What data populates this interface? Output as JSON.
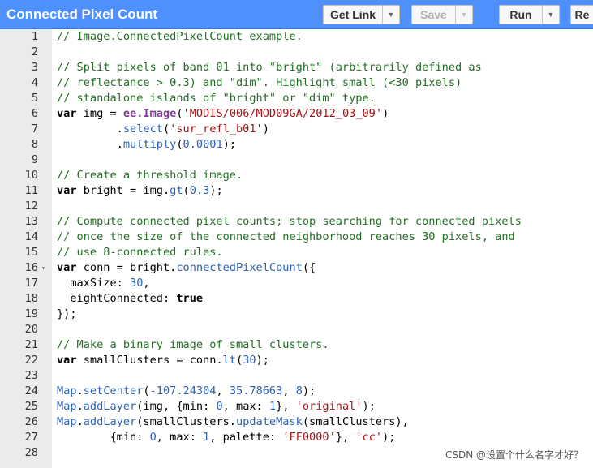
{
  "header": {
    "title": "Connected Pixel Count",
    "get_link_label": "Get Link",
    "save_label": "Save",
    "run_label": "Run",
    "reset_label": "Re"
  },
  "editor": {
    "lines": [
      {
        "n": "1",
        "parts": [
          [
            "c",
            "// Image.ConnectedPixelCount example."
          ]
        ]
      },
      {
        "n": "2",
        "parts": []
      },
      {
        "n": "3",
        "parts": [
          [
            "c",
            "// Split pixels of band 01 into \"bright\" (arbitrarily defined as"
          ]
        ]
      },
      {
        "n": "4",
        "parts": [
          [
            "c",
            "// reflectance > 0.3) and \"dim\". Highlight small (<30 pixels)"
          ]
        ]
      },
      {
        "n": "5",
        "parts": [
          [
            "c",
            "// standalone islands of \"bright\" or \"dim\" type."
          ]
        ]
      },
      {
        "n": "6",
        "parts": [
          [
            "k",
            "var"
          ],
          [
            "p",
            " img = "
          ],
          [
            "ee",
            "ee.Image"
          ],
          [
            "p",
            "("
          ],
          [
            "s",
            "'MODIS/006/MOD09GA/2012_03_09'"
          ],
          [
            "p",
            ")"
          ]
        ]
      },
      {
        "n": "7",
        "parts": [
          [
            "g",
            "         "
          ],
          [
            "p",
            "."
          ],
          [
            "f",
            "select"
          ],
          [
            "p",
            "("
          ],
          [
            "s",
            "'sur_refl_b01'"
          ],
          [
            "p",
            ")"
          ]
        ]
      },
      {
        "n": "8",
        "parts": [
          [
            "g",
            "         "
          ],
          [
            "p",
            "."
          ],
          [
            "f",
            "multiply"
          ],
          [
            "p",
            "("
          ],
          [
            "n",
            "0.0001"
          ],
          [
            "p",
            ");"
          ]
        ]
      },
      {
        "n": "9",
        "parts": []
      },
      {
        "n": "10",
        "parts": [
          [
            "c",
            "// Create a threshold image."
          ]
        ]
      },
      {
        "n": "11",
        "parts": [
          [
            "k",
            "var"
          ],
          [
            "p",
            " bright = img."
          ],
          [
            "f",
            "gt"
          ],
          [
            "p",
            "("
          ],
          [
            "n",
            "0.3"
          ],
          [
            "p",
            ");"
          ]
        ]
      },
      {
        "n": "12",
        "parts": []
      },
      {
        "n": "13",
        "parts": [
          [
            "c",
            "// Compute connected pixel counts; stop searching for connected pixels"
          ]
        ]
      },
      {
        "n": "14",
        "parts": [
          [
            "c",
            "// once the size of the connected neighborhood reaches 30 pixels, and"
          ]
        ]
      },
      {
        "n": "15",
        "parts": [
          [
            "c",
            "// use 8-connected rules."
          ]
        ]
      },
      {
        "n": "16",
        "fold": true,
        "parts": [
          [
            "k",
            "var"
          ],
          [
            "p",
            " conn = bright."
          ],
          [
            "f",
            "connectedPixelCount"
          ],
          [
            "p",
            "({"
          ]
        ]
      },
      {
        "n": "17",
        "parts": [
          [
            "p",
            "  maxSize: "
          ],
          [
            "n",
            "30"
          ],
          [
            "p",
            ","
          ]
        ]
      },
      {
        "n": "18",
        "parts": [
          [
            "p",
            "  eightConnected: "
          ],
          [
            "k",
            "true"
          ]
        ]
      },
      {
        "n": "19",
        "parts": [
          [
            "p",
            "});"
          ]
        ]
      },
      {
        "n": "20",
        "parts": []
      },
      {
        "n": "21",
        "parts": [
          [
            "c",
            "// Make a binary image of small clusters."
          ]
        ]
      },
      {
        "n": "22",
        "parts": [
          [
            "k",
            "var"
          ],
          [
            "p",
            " smallClusters = conn."
          ],
          [
            "f",
            "lt"
          ],
          [
            "p",
            "("
          ],
          [
            "n",
            "30"
          ],
          [
            "p",
            ");"
          ]
        ]
      },
      {
        "n": "23",
        "parts": []
      },
      {
        "n": "24",
        "parts": [
          [
            "f",
            "Map"
          ],
          [
            "p",
            "."
          ],
          [
            "f",
            "setCenter"
          ],
          [
            "p",
            "("
          ],
          [
            "n",
            "-107.24304"
          ],
          [
            "p",
            ", "
          ],
          [
            "n",
            "35.78663"
          ],
          [
            "p",
            ", "
          ],
          [
            "n",
            "8"
          ],
          [
            "p",
            ");"
          ]
        ]
      },
      {
        "n": "25",
        "parts": [
          [
            "f",
            "Map"
          ],
          [
            "p",
            "."
          ],
          [
            "f",
            "addLayer"
          ],
          [
            "p",
            "(img, {min: "
          ],
          [
            "n",
            "0"
          ],
          [
            "p",
            ", max: "
          ],
          [
            "n",
            "1"
          ],
          [
            "p",
            "}, "
          ],
          [
            "s",
            "'original'"
          ],
          [
            "p",
            ");"
          ]
        ]
      },
      {
        "n": "26",
        "parts": [
          [
            "f",
            "Map"
          ],
          [
            "p",
            "."
          ],
          [
            "f",
            "addLayer"
          ],
          [
            "p",
            "(smallClusters."
          ],
          [
            "f",
            "updateMask"
          ],
          [
            "p",
            "(smallClusters),"
          ]
        ]
      },
      {
        "n": "27",
        "parts": [
          [
            "g",
            "      "
          ],
          [
            "p",
            "  {min: "
          ],
          [
            "n",
            "0"
          ],
          [
            "p",
            ", max: "
          ],
          [
            "n",
            "1"
          ],
          [
            "p",
            ", palette: "
          ],
          [
            "s",
            "'FF0000'"
          ],
          [
            "p",
            "}, "
          ],
          [
            "s",
            "'cc'"
          ],
          [
            "p",
            ");"
          ]
        ]
      },
      {
        "n": "28",
        "parts": []
      }
    ]
  },
  "watermark": "CSDN @设置个什么名字才好？"
}
